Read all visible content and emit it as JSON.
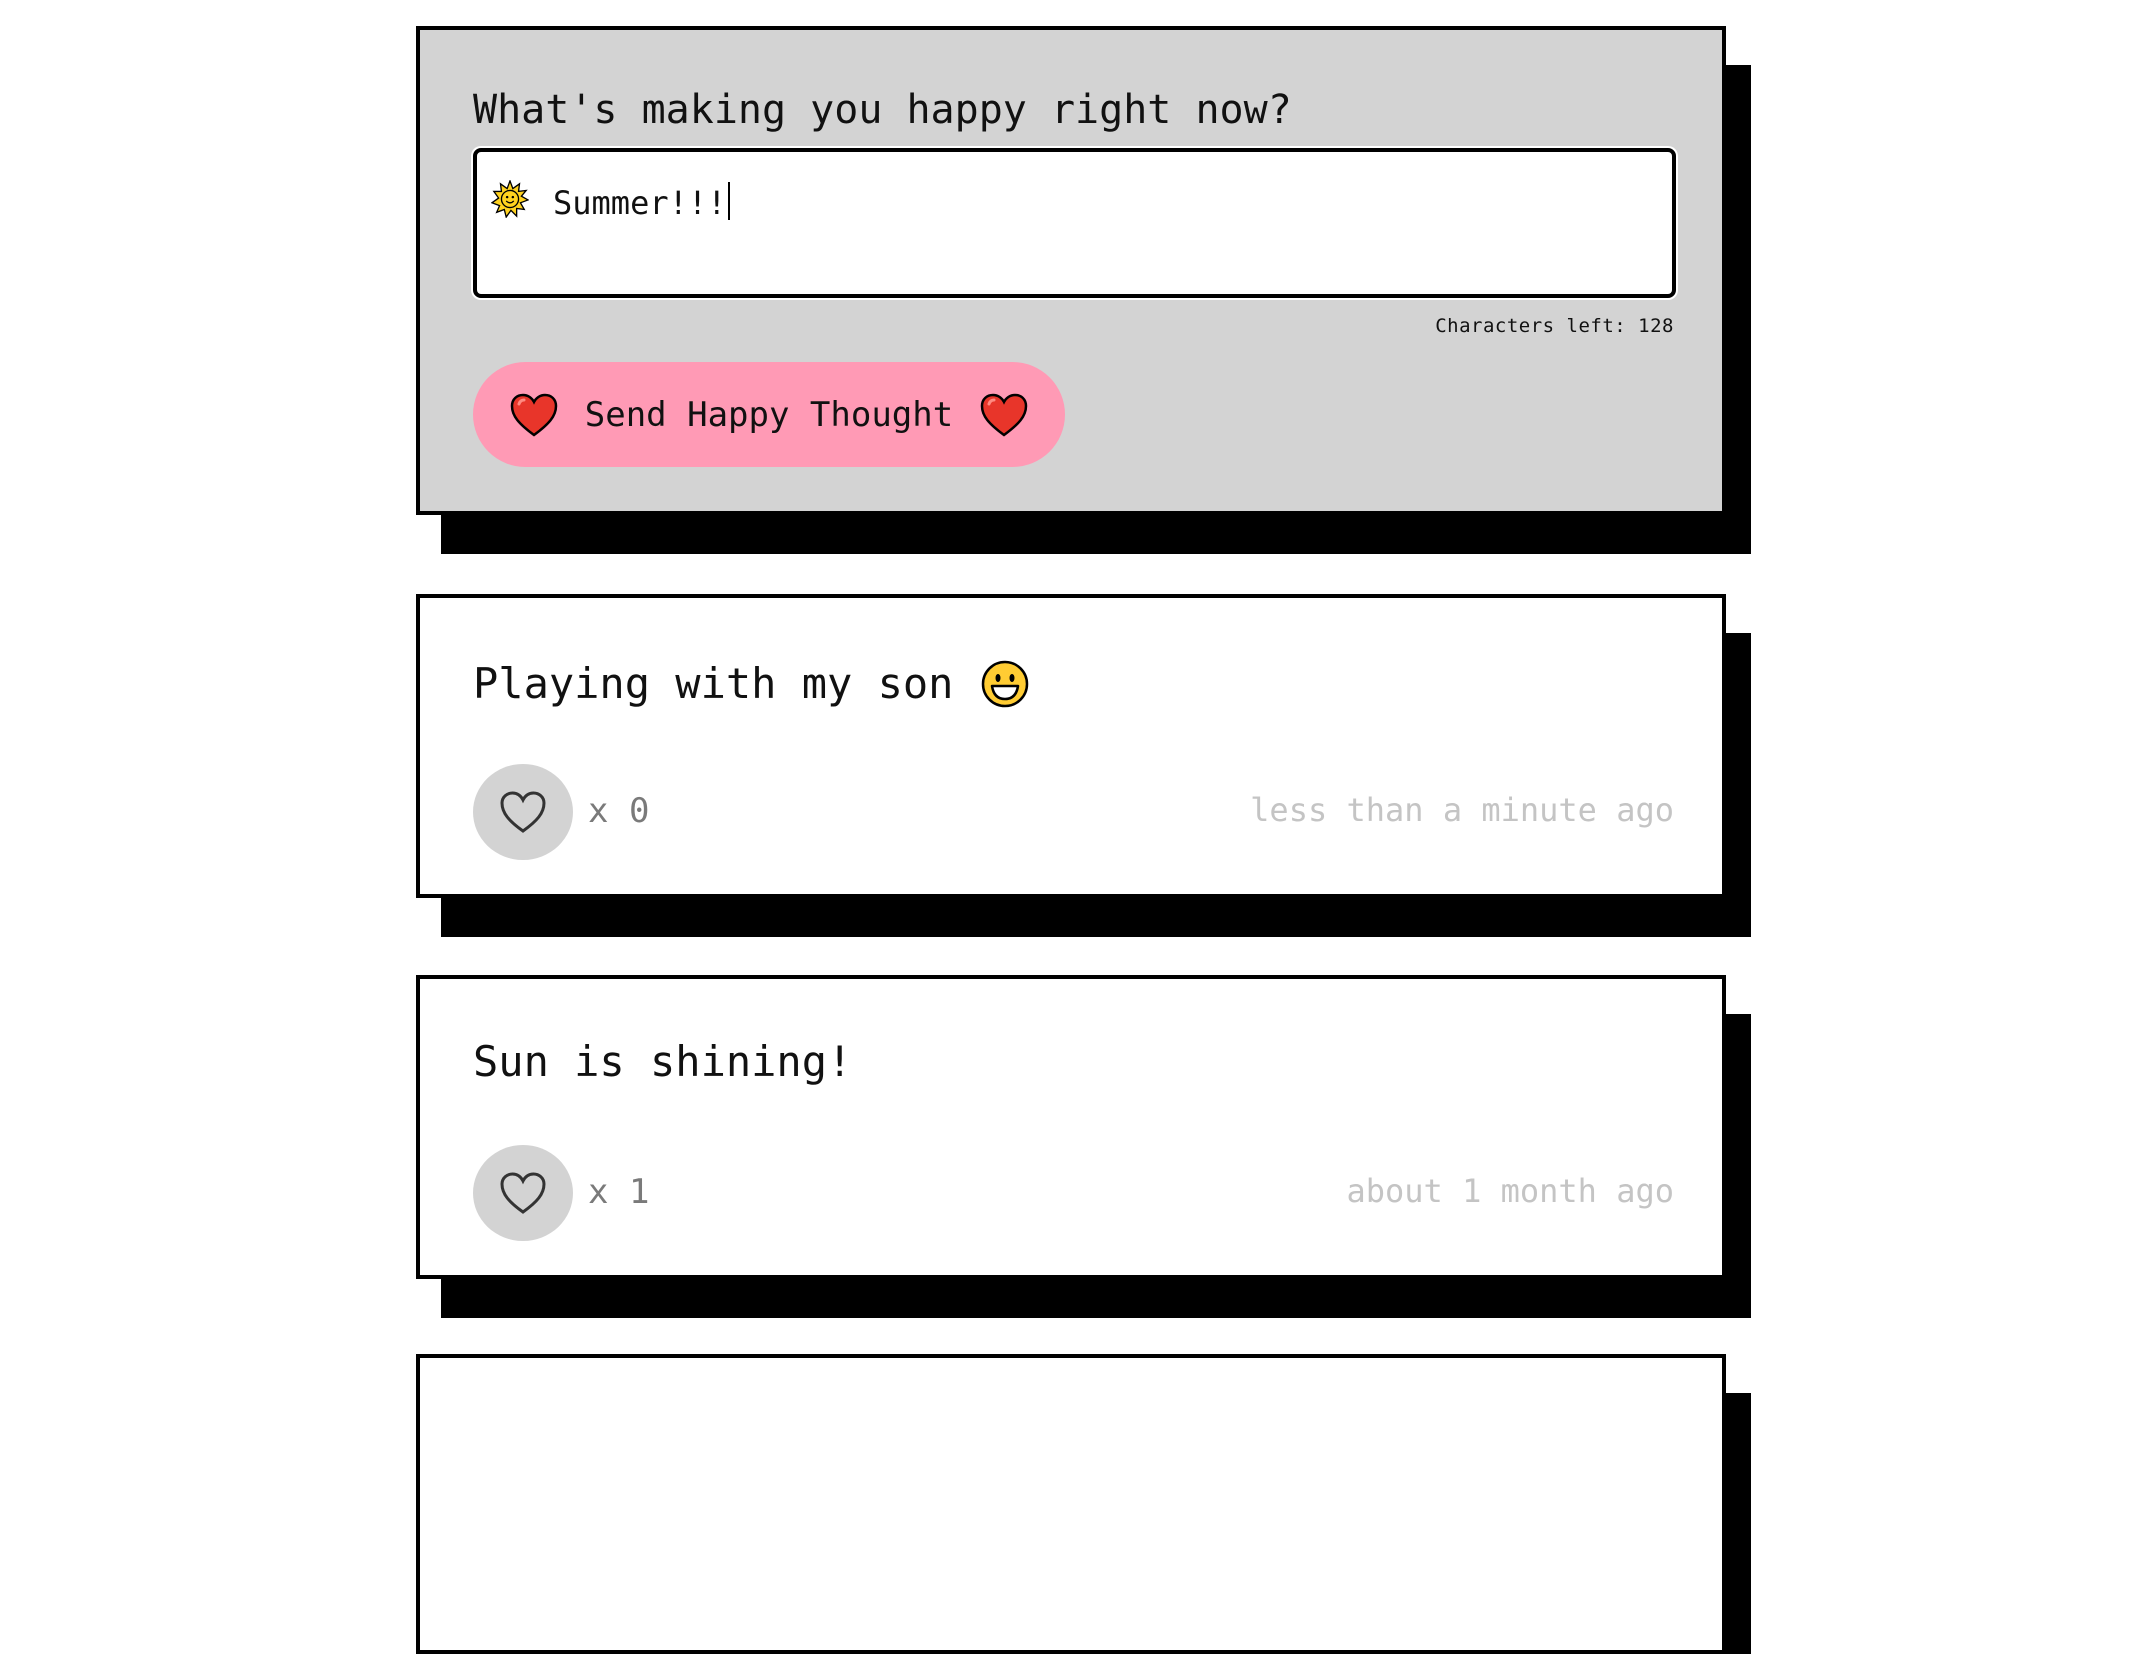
{
  "form": {
    "title": "What's making you happy right now?",
    "input_value": "Summer!!!",
    "input_icon": "sun-emoji-icon",
    "char_count": "Characters left: 128",
    "send_label": "Send Happy Thought",
    "send_icons": [
      "heart-emoji-icon",
      "heart-emoji-icon"
    ]
  },
  "thoughts": [
    {
      "message": "Playing with my son",
      "emoji": "grinning-face-icon",
      "likes": "x 0",
      "time": "less than a minute ago"
    },
    {
      "message": "Sun is shining!",
      "likes": "x 1",
      "time": "about 1 month ago"
    },
    {
      "message": "",
      "likes": "",
      "time": ""
    }
  ],
  "colors": {
    "form_background": "#d3d3d3",
    "button_pink": "#ff9ab5",
    "like_button_gray": "#d3d3d3",
    "timestamp_gray": "#c4c4c4",
    "like_count_gray": "#7a7a7a",
    "border": "#000000"
  }
}
